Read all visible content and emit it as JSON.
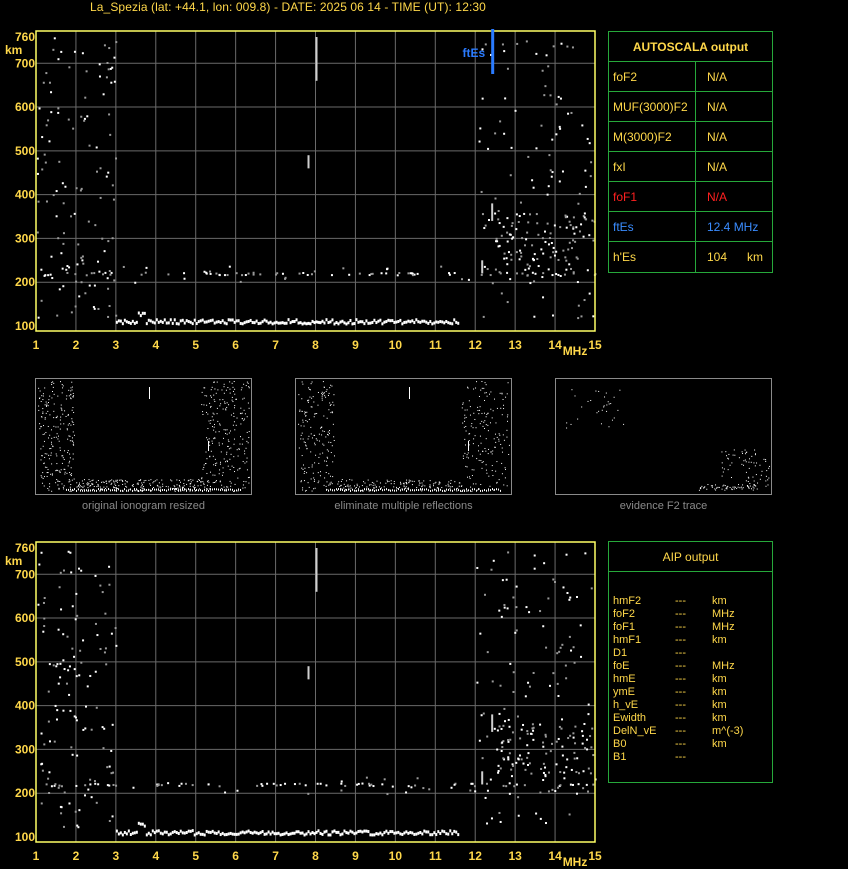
{
  "header": {
    "title": "La_Spezia (lat: +44.1, lon: 009.8) - DATE: 2025 06 14 - TIME (UT): 12:30"
  },
  "ionogram": {
    "y_unit": "km",
    "x_unit": "MHz",
    "y_ticks": [
      "760",
      "700",
      "600",
      "500",
      "400",
      "300",
      "200",
      "100"
    ],
    "x_ticks": [
      "1",
      "2",
      "3",
      "4",
      "5",
      "6",
      "7",
      "8",
      "9",
      "10",
      "11",
      "12",
      "13",
      "14",
      "15"
    ],
    "marker_label": "ftEs",
    "frame_color": "#ffff66",
    "grid_color": "#6a6a6a",
    "marker_color": "#2a7bff"
  },
  "autoscala": {
    "title": "AUTOSCALA output",
    "rows": [
      {
        "name": "foF2",
        "value": "N/A",
        "unit": "",
        "color": "#ffd84a"
      },
      {
        "name": "MUF(3000)F2",
        "value": "N/A",
        "unit": "",
        "color": "#ffd84a"
      },
      {
        "name": "M(3000)F2",
        "value": "N/A",
        "unit": "",
        "color": "#ffd84a"
      },
      {
        "name": "fxI",
        "value": "N/A",
        "unit": "",
        "color": "#ffd84a"
      },
      {
        "name": "foF1",
        "value": "N/A",
        "unit": "",
        "color": "#ff2020"
      },
      {
        "name": "ftEs",
        "value": "12.4 MHz",
        "unit": "",
        "color": "#3a8cff"
      },
      {
        "name": "h'Es",
        "value": "104",
        "unit": "km",
        "color": "#ffd84a"
      }
    ]
  },
  "thumbnails": [
    {
      "caption": "original ionogram resized"
    },
    {
      "caption": "eliminate multiple reflections"
    },
    {
      "caption": "evidence F2 trace"
    }
  ],
  "aip": {
    "title": "AIP output",
    "rows": [
      {
        "name": "hmF2",
        "value": "---",
        "unit": "km"
      },
      {
        "name": "foF2",
        "value": "---",
        "unit": "MHz"
      },
      {
        "name": "foF1",
        "value": "---",
        "unit": "MHz"
      },
      {
        "name": "hmF1",
        "value": "---",
        "unit": "km"
      },
      {
        "name": "D1",
        "value": "---",
        "unit": ""
      },
      {
        "name": "foE",
        "value": "---",
        "unit": "MHz"
      },
      {
        "name": "hmE",
        "value": "---",
        "unit": "km"
      },
      {
        "name": "ymE",
        "value": "---",
        "unit": "km"
      },
      {
        "name": "h_vE",
        "value": "---",
        "unit": "km"
      },
      {
        "name": "Ewidth",
        "value": "---",
        "unit": "km"
      },
      {
        "name": "DelN_vE",
        "value": "---",
        "unit": "m^(-3)"
      },
      {
        "name": "B0",
        "value": "---",
        "unit": "km"
      },
      {
        "name": "B1",
        "value": "---",
        "unit": ""
      }
    ]
  }
}
